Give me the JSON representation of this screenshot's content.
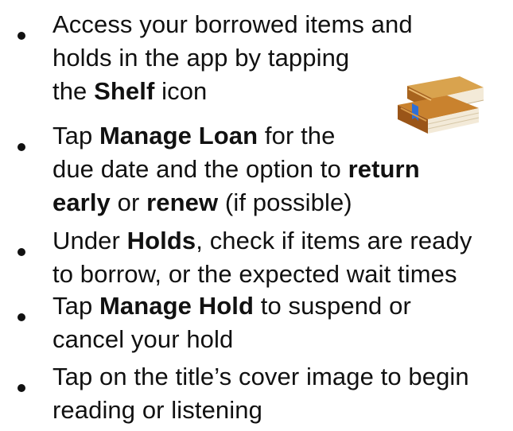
{
  "document": {
    "items": [
      {
        "lines": [
          [
            {
              "text": "Access your borrowed items and"
            }
          ],
          [
            {
              "text": "holds in the app by tapping"
            }
          ],
          [
            {
              "text": " the "
            },
            {
              "text": "Shelf",
              "bold": true
            },
            {
              "text": " icon"
            }
          ]
        ]
      },
      {
        "lines": [
          [
            {
              "text": "Tap "
            },
            {
              "text": "Manage Loan",
              "bold": true
            },
            {
              "text": " for the"
            }
          ],
          [
            {
              "text": "due date and the option to "
            },
            {
              "text": "return",
              "bold": true
            }
          ],
          [
            {
              "text": "early",
              "bold": true
            },
            {
              "text": " or "
            },
            {
              "text": "renew",
              "bold": true
            },
            {
              "text": " (if possible)"
            }
          ]
        ]
      },
      {
        "lines": [
          [
            {
              "text": "Under "
            },
            {
              "text": "Holds",
              "bold": true
            },
            {
              "text": ", check if items are ready"
            }
          ],
          [
            {
              "text": "to borrow, or the expected wait times"
            }
          ]
        ]
      },
      {
        "lines": [
          [
            {
              "text": "Tap "
            },
            {
              "text": "Manage Hold",
              "bold": true
            },
            {
              "text": " to suspend or"
            }
          ],
          [
            {
              "text": "cancel your hold"
            }
          ]
        ]
      },
      {
        "lines": [
          [
            {
              "text": "Tap on the title’s cover image to begin"
            }
          ],
          [
            {
              "text": "reading or listening"
            }
          ]
        ]
      }
    ],
    "icon": "shelf-books-icon",
    "colors": {
      "text": "#111111",
      "book_brown": "#a8641e",
      "book_light": "#d49a4a",
      "pages": "#f3ead8",
      "bookmark": "#2f6fd6"
    }
  }
}
